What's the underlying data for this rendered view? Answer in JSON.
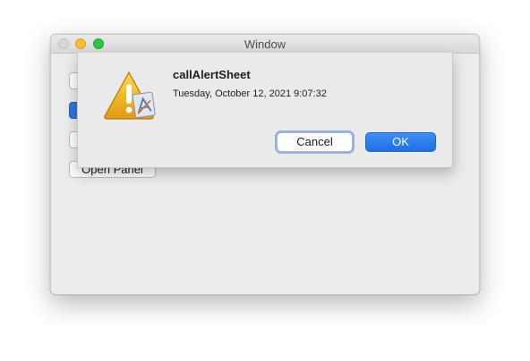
{
  "window": {
    "title": "Window",
    "background_buttons": [
      "",
      "",
      "",
      "Open Panel"
    ]
  },
  "alert": {
    "title": "callAlertSheet",
    "message": "Tuesday, October 12, 2021 9:07:32",
    "icon": "caution-warning-icon",
    "cancel_label": "Cancel",
    "ok_label": "OK"
  },
  "colors": {
    "accent": "#2a78e8",
    "close": "#d8d8d8",
    "minimize": "#fdbc2e",
    "zoom": "#2ac940",
    "warning": "#f2b92b"
  }
}
